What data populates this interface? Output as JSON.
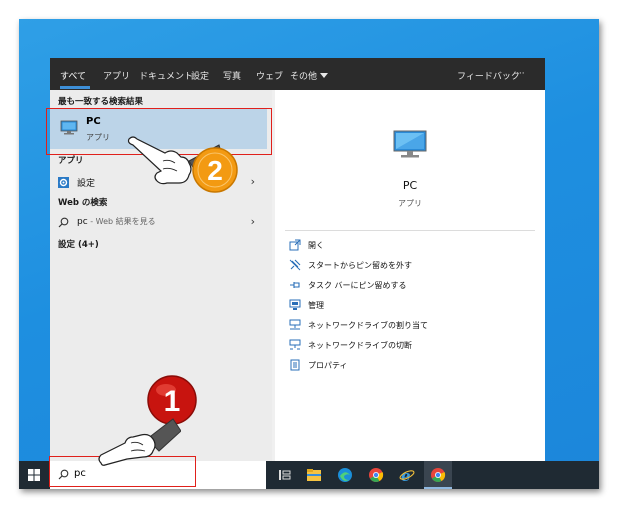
{
  "tabs": [
    {
      "label": "すべて"
    },
    {
      "label": "アプリ"
    },
    {
      "label": "ドキュメント"
    },
    {
      "label": "設定"
    },
    {
      "label": "写真"
    },
    {
      "label": "ウェブ"
    },
    {
      "label": "その他"
    }
  ],
  "feedback": "フィードバック",
  "more": "···",
  "results": {
    "best_match_heading": "最も一致する検索結果",
    "best_match": {
      "title": "PC",
      "subtitle": "アプリ",
      "icon": "computer-icon"
    },
    "apps_heading": "アプリ",
    "settings_item": {
      "label": "設定",
      "icon": "gear-icon"
    },
    "web_heading": "Web の検索",
    "web_item": {
      "query": "pc",
      "suffix": " - Web 結果を見る",
      "icon": "search-icon"
    },
    "settings_heading": "設定 (4+)"
  },
  "preview": {
    "title": "PC",
    "subtitle": "アプリ",
    "actions": [
      {
        "label": "開く",
        "icon": "open-icon"
      },
      {
        "label": "スタートからピン留めを外す",
        "icon": "unpin-icon"
      },
      {
        "label": "タスク バーにピン留めする",
        "icon": "pin-icon"
      },
      {
        "label": "管理",
        "icon": "manage-icon"
      },
      {
        "label": "ネットワークドライブの割り当て",
        "icon": "map-drive-icon"
      },
      {
        "label": "ネットワークドライブの切断",
        "icon": "disconnect-drive-icon"
      },
      {
        "label": "プロパティ",
        "icon": "properties-icon"
      }
    ]
  },
  "taskbar": {
    "search_value": "pc",
    "icons": [
      "windows-logo-icon",
      "task-view-icon",
      "file-explorer-icon",
      "edge-icon",
      "chrome-icon",
      "ie-icon",
      "chrome-icon"
    ]
  },
  "annotations": {
    "step1": "1",
    "step2": "2"
  },
  "colors": {
    "accent": "#3d8fd8",
    "highlight": "#bcd4e8",
    "annotation_red": "#e0201b",
    "badge_orange": "#f39a12",
    "badge_red": "#c8140f"
  }
}
